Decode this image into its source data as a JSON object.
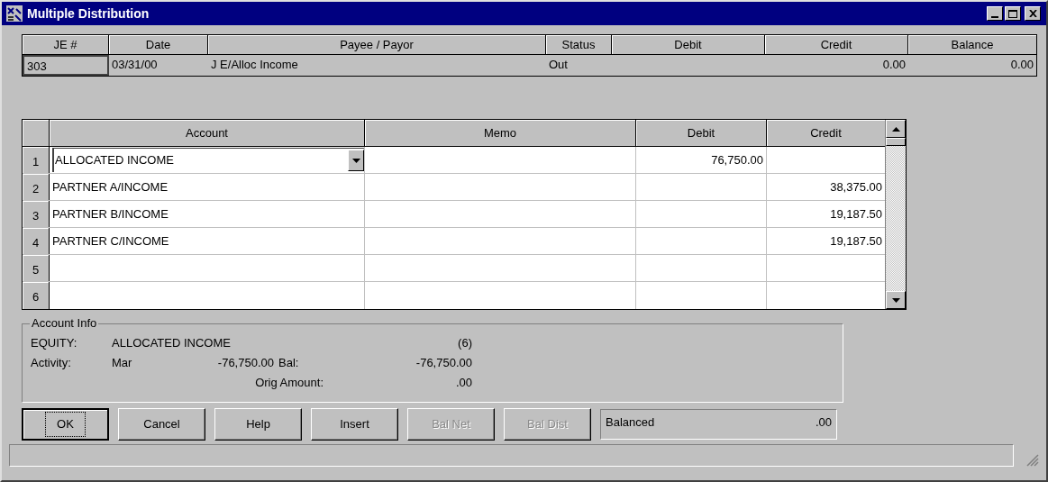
{
  "window": {
    "title": "Multiple Distribution"
  },
  "header_grid": {
    "columns": [
      "JE #",
      "Date",
      "Payee / Payor",
      "Status",
      "Debit",
      "Credit",
      "Balance"
    ],
    "row": {
      "je": "303",
      "date": "03/31/00",
      "payee": "J E/Alloc Income",
      "status": "Out",
      "credit": "0.00",
      "balance": "0.00"
    }
  },
  "distribution_grid": {
    "columns": [
      "Account",
      "Memo",
      "Debit",
      "Credit"
    ],
    "rows": [
      {
        "number": "1",
        "account": "ALLOCATED INCOME",
        "debit": "76,750.00",
        "editing": true
      },
      {
        "number": "2",
        "account": "PARTNER A/INCOME",
        "credit": "38,375.00",
        "editing": false
      },
      {
        "number": "3",
        "account": "PARTNER B/INCOME",
        "credit": "19,187.50",
        "editing": false
      },
      {
        "number": "4",
        "account": "PARTNER C/INCOME",
        "credit": "19,187.50",
        "editing": false
      },
      {
        "number": "5",
        "editing": false
      },
      {
        "number": "6",
        "editing": false
      }
    ]
  },
  "account_info": {
    "title": "Account Info",
    "type_label": "EQUITY:",
    "account": "ALLOCATED INCOME",
    "count": "(6)",
    "activity_label": "Activity:",
    "month": "Mar",
    "activity": "-76,750.00",
    "bal_label": "Bal:",
    "bal": "-76,750.00",
    "orig_label": "Orig Amount:",
    "orig": ".00"
  },
  "buttons": [
    {
      "label": "OK",
      "disabled": false,
      "default": true
    },
    {
      "label": "Cancel",
      "disabled": false,
      "default": false
    },
    {
      "label": "Help",
      "disabled": false,
      "default": false
    },
    {
      "label": "Insert",
      "disabled": false,
      "default": false
    },
    {
      "label": "Bal Net",
      "disabled": true,
      "default": false
    },
    {
      "label": "Bal Dist",
      "disabled": true,
      "default": false
    }
  ],
  "balance_status": {
    "label": "Balanced",
    "amount": ".00"
  }
}
